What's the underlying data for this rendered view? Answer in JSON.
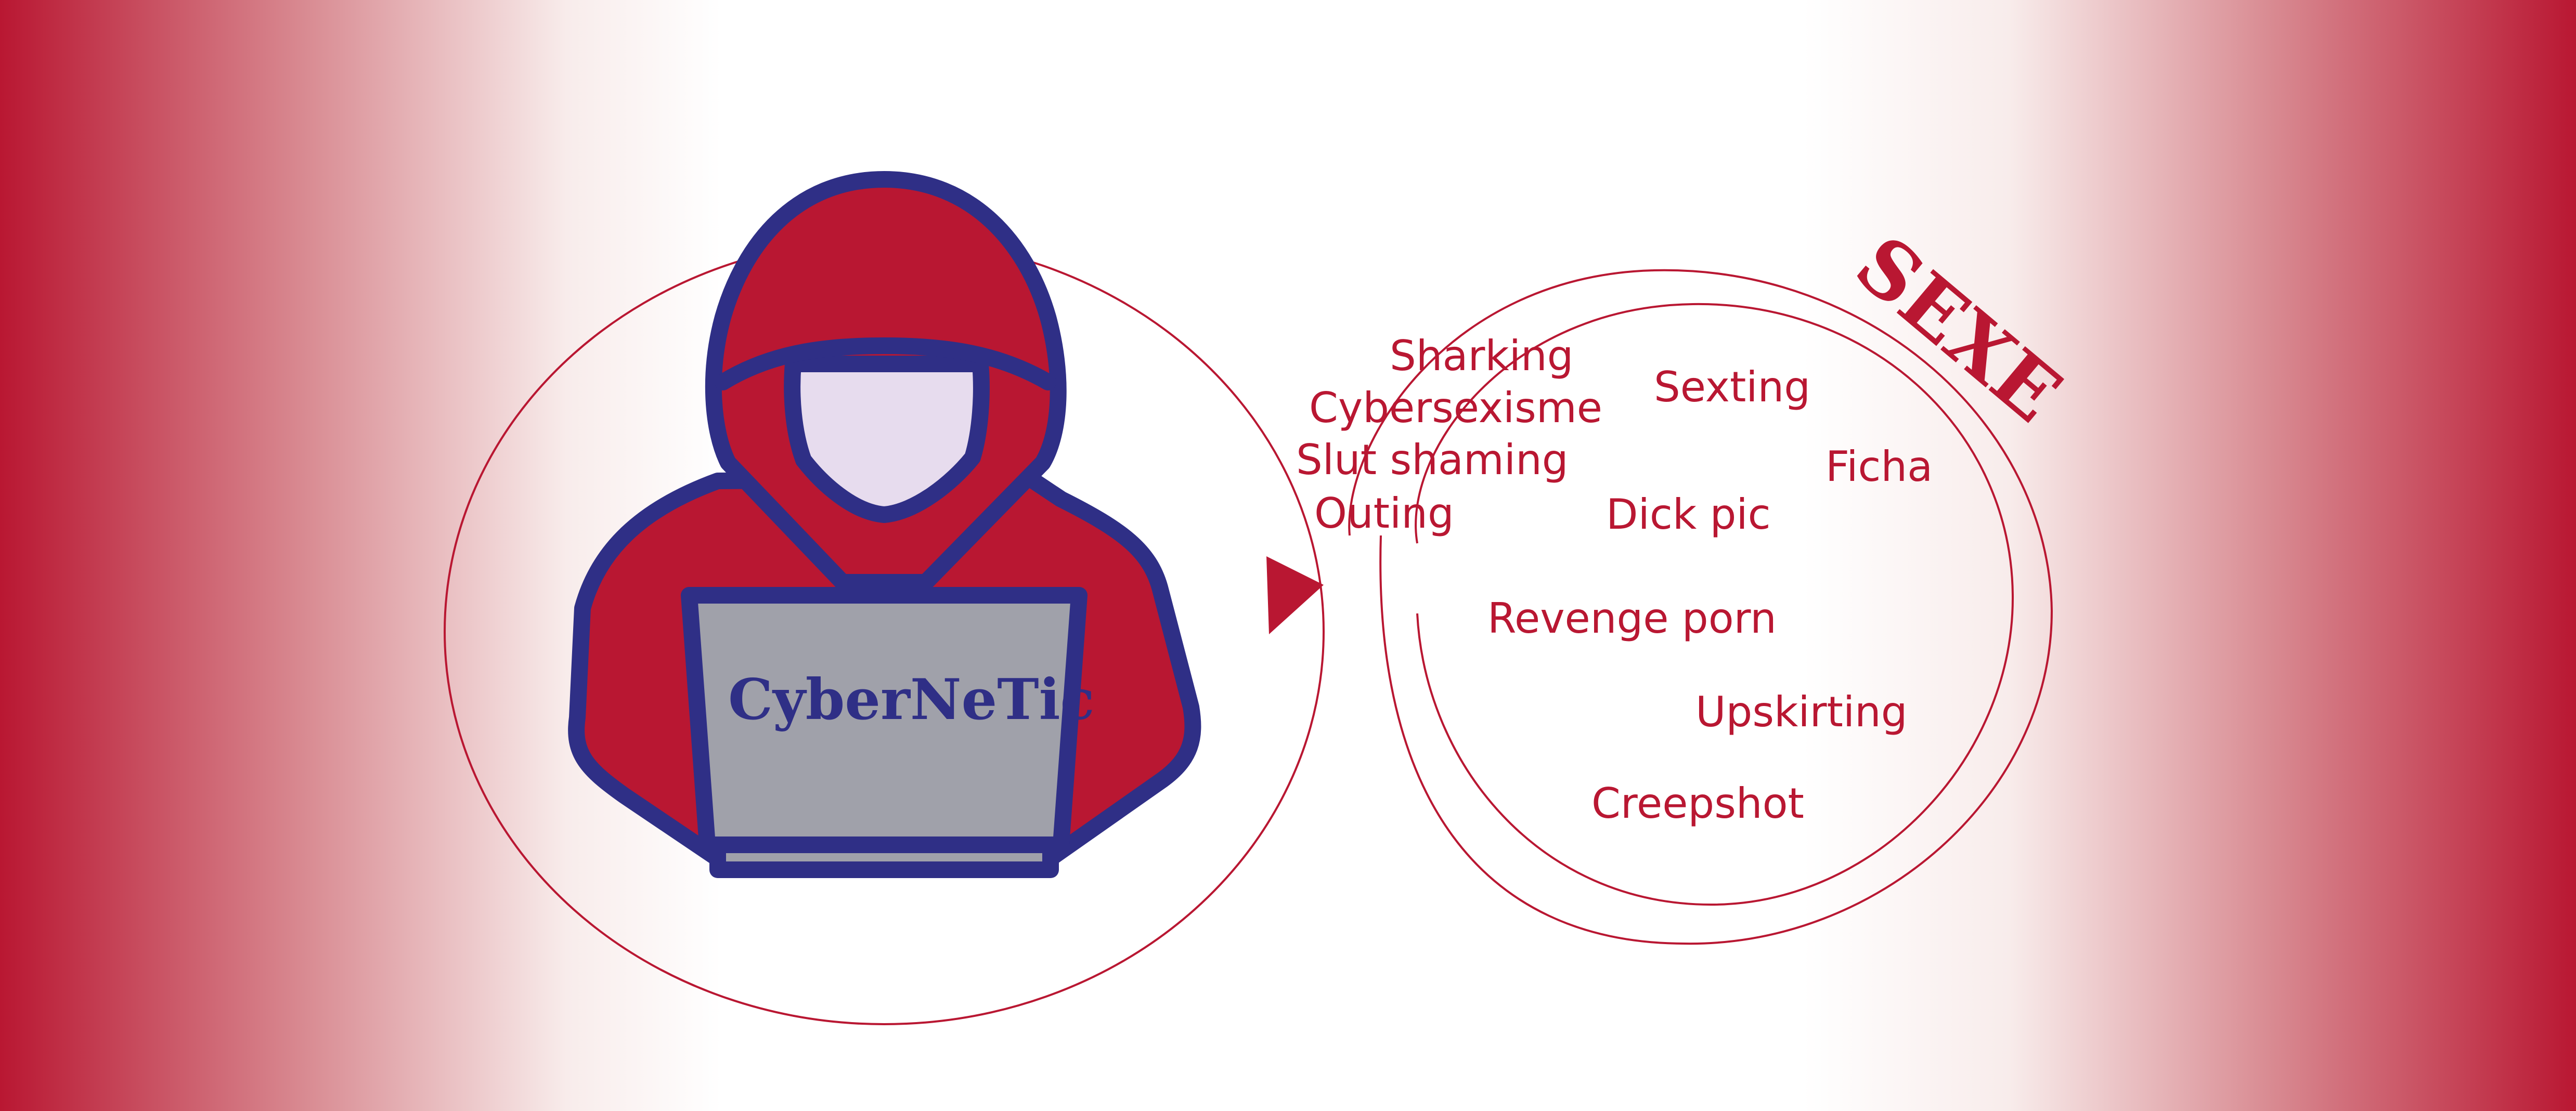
{
  "figure": {
    "brand_label": "CyberNeTic",
    "topic_label": "SEXE",
    "terms": [
      "Sharking",
      "Cybersexisme",
      "Slut shaming",
      "Outing",
      "Sexting",
      "Ficha",
      "Dick pic",
      "Revenge porn",
      "Upskirting",
      "Creepshot"
    ],
    "colors": {
      "accent_red": "#b91732",
      "navy": "#2f2f86",
      "screen_gray": "#a0a1aa",
      "face": "#e7dcee",
      "background": "#ffffff"
    },
    "icons": [
      "hooded-hacker-icon",
      "laptop-icon",
      "arrowhead-icon"
    ]
  }
}
